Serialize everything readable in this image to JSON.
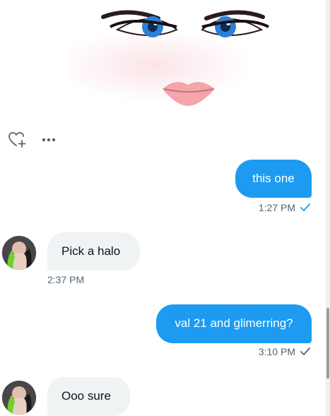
{
  "conversation": {
    "messages": [
      {
        "text": "this one",
        "time": "1:27 PM"
      },
      {
        "text": "Pick a halo",
        "time": "2:37 PM"
      },
      {
        "text": "val 21 and glimerring?",
        "time": "3:10 PM"
      },
      {
        "text": "Ooo sure"
      }
    ]
  },
  "icons": {
    "reaction": "heart-plus-icon",
    "more": "more-dots-icon",
    "read_receipt": "checkmark-icon"
  },
  "colors": {
    "accent": "#1d9bf0",
    "received_bubble": "#eff3f4",
    "meta_text": "#536471"
  }
}
